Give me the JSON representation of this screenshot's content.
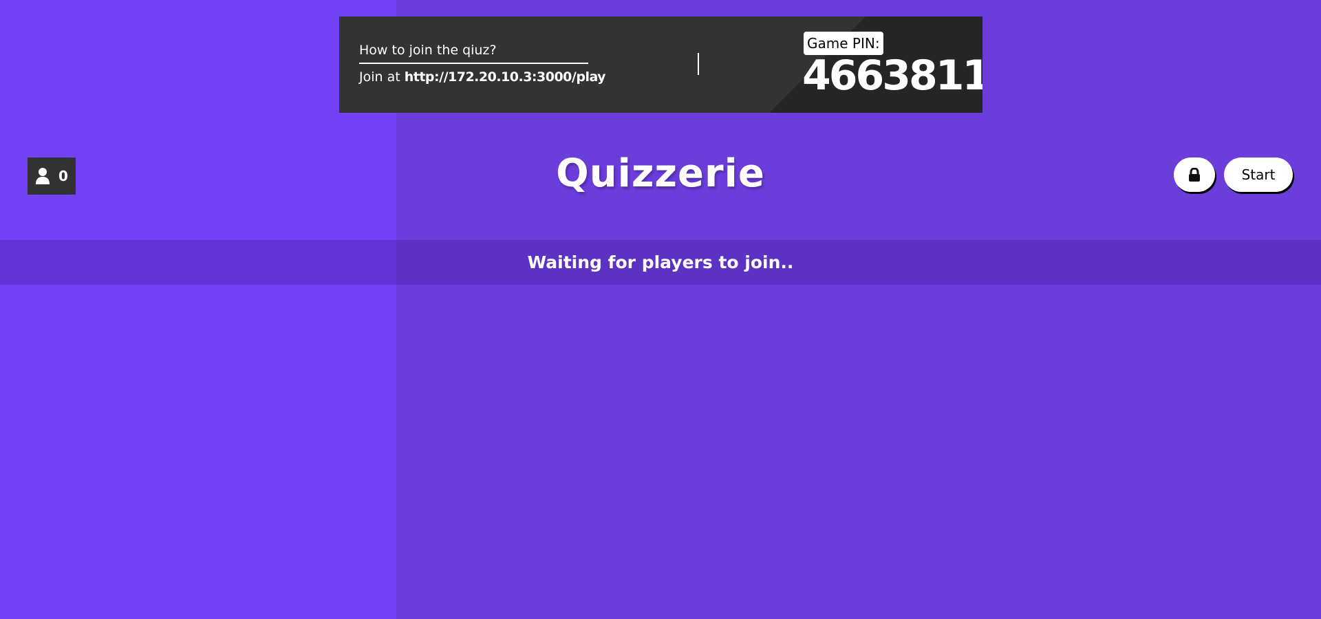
{
  "join": {
    "question": "How to join the qiuz?",
    "prefix": "Join at",
    "url": "http://172.20.10.3:3000/play"
  },
  "pin": {
    "label": "Game PIN:",
    "value": "4663811"
  },
  "players": {
    "icon": "user-icon",
    "count": "0"
  },
  "title": "Quizzerie",
  "controls": {
    "lock_icon": "lock-icon",
    "start_label": "Start"
  },
  "status": {
    "waiting_text": "Waiting for players to join.."
  },
  "colors": {
    "background_left": "#7341f5",
    "background_right": "#6b3ddb",
    "panel": "#333333",
    "panel_dark": "#252525",
    "button": "#ffffff"
  }
}
